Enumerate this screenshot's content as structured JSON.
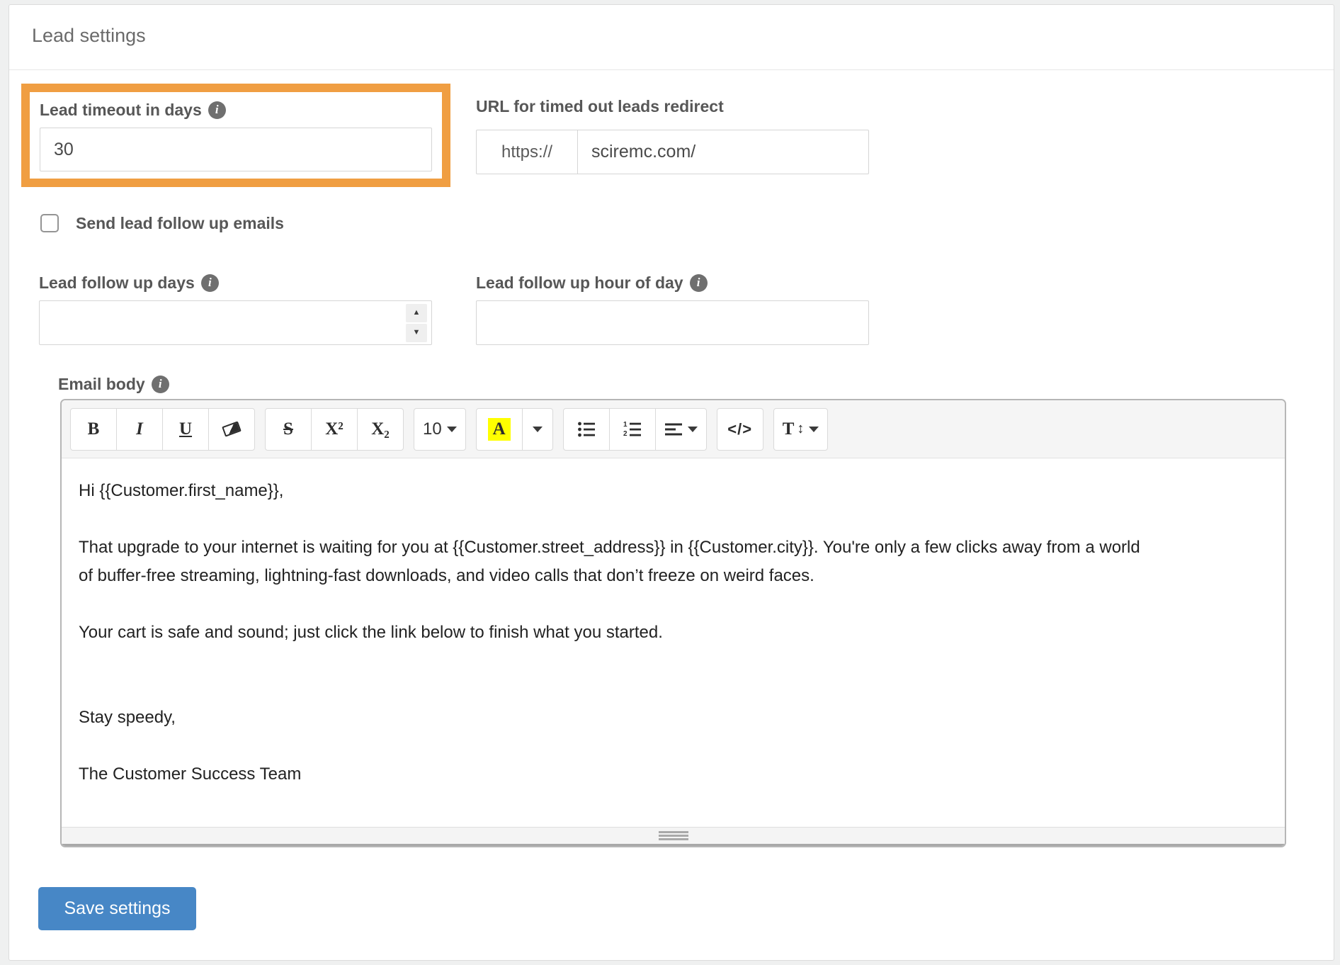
{
  "header": {
    "title": "Lead settings"
  },
  "fields": {
    "lead_timeout": {
      "label": "Lead timeout in days",
      "value": "30",
      "highlighted": true
    },
    "redirect_url": {
      "label": "URL for timed out leads redirect",
      "prefix": "https://",
      "value": "sciremc.com/"
    },
    "send_follow_up": {
      "label": "Send lead follow up emails",
      "checked": false
    },
    "follow_up_days": {
      "label": "Lead follow up days",
      "value": ""
    },
    "follow_up_hour": {
      "label": "Lead follow up hour of day",
      "value": ""
    },
    "email_body": {
      "label": "Email body"
    }
  },
  "editor": {
    "toolbar": {
      "bold": "B",
      "italic": "I",
      "underline": "U",
      "strikethrough": "S",
      "superscript": "X²",
      "subscript": "X₂",
      "font_size": "10",
      "color_letter": "A",
      "code_view": "</>",
      "line_height_letter": "T"
    },
    "paragraphs": [
      "Hi {{Customer.first_name}},",
      "",
      "That upgrade to your internet is waiting for you at {{Customer.street_address}} in {{Customer.city}}. You're only a few clicks away from a world of buffer-free streaming, lightning-fast downloads, and video calls that don’t freeze on weird faces.",
      "",
      "Your cart is safe and sound; just click the link below to finish what you started.",
      "",
      "",
      "Stay speedy,",
      "",
      "The Customer Success Team"
    ]
  },
  "icons": {
    "info": "i",
    "spinner_up": "▲",
    "spinner_down": "▼",
    "vertical_arrows": "↕"
  },
  "buttons": {
    "save": "Save settings"
  },
  "colors": {
    "highlight_orange": "#F09E42",
    "primary_blue": "#4787C6",
    "swatch_yellow": "#FFFF00"
  }
}
